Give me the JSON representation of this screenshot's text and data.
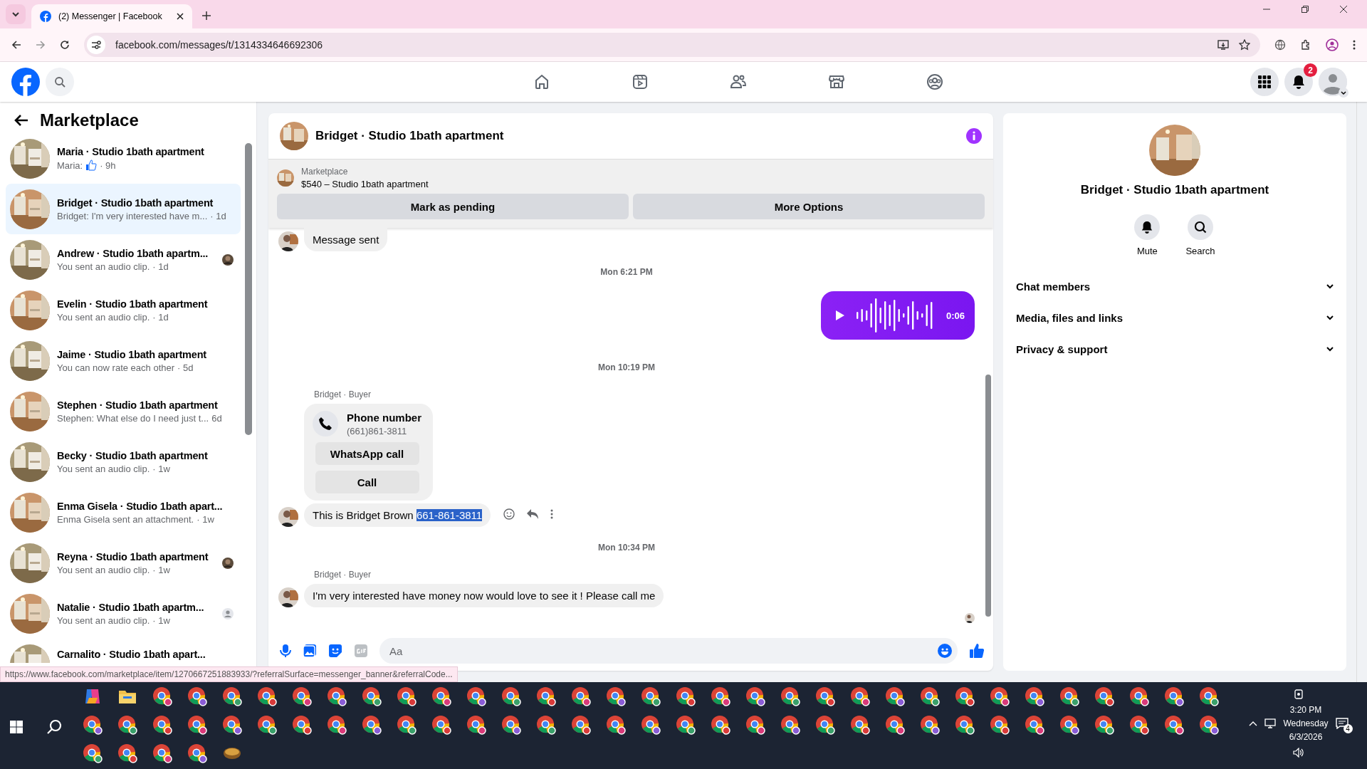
{
  "browser": {
    "tab_title": "(2) Messenger | Facebook",
    "url": "facebook.com/messages/t/1314334646692306"
  },
  "header": {
    "notification_count": "2",
    "nav": [
      {
        "kind": "home",
        "selected": false
      },
      {
        "kind": "video",
        "selected": false
      },
      {
        "kind": "friends",
        "selected": false
      },
      {
        "kind": "store",
        "selected": false
      },
      {
        "kind": "groups",
        "selected": false
      }
    ]
  },
  "sidebar": {
    "title": "Marketplace",
    "conversations": [
      {
        "name": "Maria · Studio 1bath apartment",
        "preview": "Maria:",
        "like_icon": true,
        "time": "· 9h",
        "selected": false
      },
      {
        "name": "Bridget · Studio 1bath apartment",
        "preview": "Bridget: I'm very interested have m...",
        "time": "· 1d",
        "selected": true
      },
      {
        "name": "Andrew · Studio 1bath apartm...",
        "preview": "You sent an audio clip.",
        "time": "· 1d",
        "selected": false,
        "seen_photo": true
      },
      {
        "name": "Evelin · Studio 1bath apartment",
        "preview": "You sent an audio clip.",
        "time": "· 1d",
        "selected": false
      },
      {
        "name": "Jaime · Studio 1bath apartment",
        "preview": "You can now rate each other",
        "time": "· 5d",
        "selected": false
      },
      {
        "name": "Stephen · Studio 1bath apartment",
        "preview": "Stephen: What else do I need just t...",
        "time": "6d",
        "selected": false
      },
      {
        "name": "Becky · Studio 1bath apartment",
        "preview": "You sent an audio clip.",
        "time": "· 1w",
        "selected": false
      },
      {
        "name": "Enma Gisela · Studio 1bath apart...",
        "preview": "Enma Gisela sent an attachment.",
        "time": "· 1w",
        "selected": false
      },
      {
        "name": "Reyna · Studio 1bath apartment",
        "preview": "You sent an audio clip.",
        "time": "· 1w",
        "selected": false,
        "seen_photo": true
      },
      {
        "name": "Natalie · Studio 1bath apartm...",
        "preview": "You sent an audio clip.",
        "time": "· 1w",
        "selected": false,
        "seen_default": true
      },
      {
        "name": "Carnalito · Studio 1bath apart..."
      }
    ]
  },
  "chat": {
    "title": "Bridget · Studio 1bath apartment",
    "listing": {
      "label": "Marketplace",
      "text": "$540 – Studio 1bath apartment",
      "buttons": [
        "Mark as pending",
        "More Options"
      ]
    },
    "messages": [
      {
        "kind": "incoming",
        "text": "Message sent"
      },
      {
        "kind": "time",
        "text": "Mon 6:21 PM"
      },
      {
        "kind": "audio",
        "duration": "0:06"
      },
      {
        "kind": "time",
        "text": "Mon 10:19 PM"
      },
      {
        "kind": "sender",
        "text": "Bridget · Buyer"
      },
      {
        "kind": "contact",
        "title": "Phone number",
        "number": "(661)861-3811",
        "buttons": [
          "WhatsApp call",
          "Call"
        ]
      },
      {
        "kind": "incoming",
        "text": "This is Bridget Brown ",
        "selected_text": "661-861-3811",
        "hovered": true
      },
      {
        "kind": "time",
        "text": "Mon 10:34 PM"
      },
      {
        "kind": "sender",
        "text": "Bridget · Buyer"
      },
      {
        "kind": "incoming",
        "text": "I'm very interested have money now would love to see it ! Please call me"
      }
    ],
    "composer": {
      "placeholder": "Aa"
    }
  },
  "info": {
    "title": "Bridget · Studio 1bath apartment",
    "actions": [
      {
        "kind": "mute",
        "label": "Mute"
      },
      {
        "kind": "search",
        "label": "Search"
      }
    ],
    "sections": [
      {
        "label": "Chat members",
        "expanded": false
      },
      {
        "label": "Media, files and links",
        "expanded": false
      },
      {
        "label": "Privacy & support",
        "expanded": false
      }
    ]
  },
  "status_link": "https://www.facebook.com/marketplace/item/1270667251883933/?referralSurface=messenger_banner&referralCode...",
  "taskbar": {
    "time": "3:20 PM",
    "day": "Wednesday",
    "date": "6/3/2026",
    "notifications": "4"
  }
}
